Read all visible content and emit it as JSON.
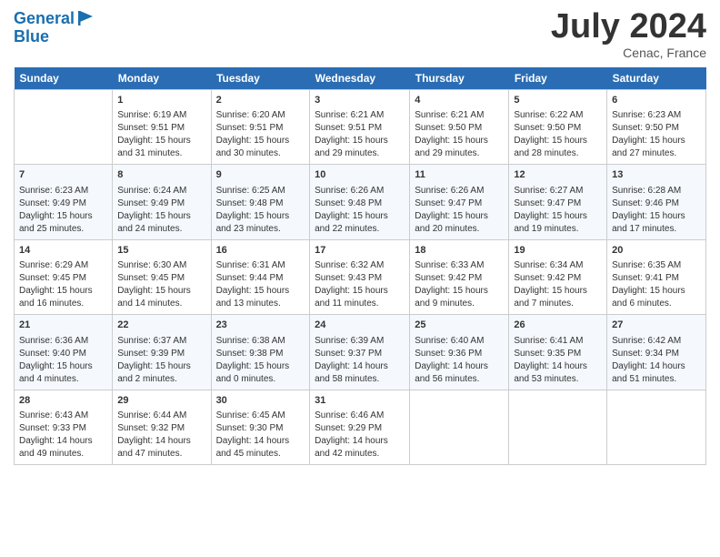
{
  "header": {
    "logo_general": "General",
    "logo_blue": "Blue",
    "month_title": "July 2024",
    "location": "Cenac, France"
  },
  "weekdays": [
    "Sunday",
    "Monday",
    "Tuesday",
    "Wednesday",
    "Thursday",
    "Friday",
    "Saturday"
  ],
  "weeks": [
    [
      {
        "day": "",
        "sunrise": "",
        "sunset": "",
        "daylight": ""
      },
      {
        "day": "1",
        "sunrise": "Sunrise: 6:19 AM",
        "sunset": "Sunset: 9:51 PM",
        "daylight": "Daylight: 15 hours and 31 minutes."
      },
      {
        "day": "2",
        "sunrise": "Sunrise: 6:20 AM",
        "sunset": "Sunset: 9:51 PM",
        "daylight": "Daylight: 15 hours and 30 minutes."
      },
      {
        "day": "3",
        "sunrise": "Sunrise: 6:21 AM",
        "sunset": "Sunset: 9:51 PM",
        "daylight": "Daylight: 15 hours and 29 minutes."
      },
      {
        "day": "4",
        "sunrise": "Sunrise: 6:21 AM",
        "sunset": "Sunset: 9:50 PM",
        "daylight": "Daylight: 15 hours and 29 minutes."
      },
      {
        "day": "5",
        "sunrise": "Sunrise: 6:22 AM",
        "sunset": "Sunset: 9:50 PM",
        "daylight": "Daylight: 15 hours and 28 minutes."
      },
      {
        "day": "6",
        "sunrise": "Sunrise: 6:23 AM",
        "sunset": "Sunset: 9:50 PM",
        "daylight": "Daylight: 15 hours and 27 minutes."
      }
    ],
    [
      {
        "day": "7",
        "sunrise": "Sunrise: 6:23 AM",
        "sunset": "Sunset: 9:49 PM",
        "daylight": "Daylight: 15 hours and 25 minutes."
      },
      {
        "day": "8",
        "sunrise": "Sunrise: 6:24 AM",
        "sunset": "Sunset: 9:49 PM",
        "daylight": "Daylight: 15 hours and 24 minutes."
      },
      {
        "day": "9",
        "sunrise": "Sunrise: 6:25 AM",
        "sunset": "Sunset: 9:48 PM",
        "daylight": "Daylight: 15 hours and 23 minutes."
      },
      {
        "day": "10",
        "sunrise": "Sunrise: 6:26 AM",
        "sunset": "Sunset: 9:48 PM",
        "daylight": "Daylight: 15 hours and 22 minutes."
      },
      {
        "day": "11",
        "sunrise": "Sunrise: 6:26 AM",
        "sunset": "Sunset: 9:47 PM",
        "daylight": "Daylight: 15 hours and 20 minutes."
      },
      {
        "day": "12",
        "sunrise": "Sunrise: 6:27 AM",
        "sunset": "Sunset: 9:47 PM",
        "daylight": "Daylight: 15 hours and 19 minutes."
      },
      {
        "day": "13",
        "sunrise": "Sunrise: 6:28 AM",
        "sunset": "Sunset: 9:46 PM",
        "daylight": "Daylight: 15 hours and 17 minutes."
      }
    ],
    [
      {
        "day": "14",
        "sunrise": "Sunrise: 6:29 AM",
        "sunset": "Sunset: 9:45 PM",
        "daylight": "Daylight: 15 hours and 16 minutes."
      },
      {
        "day": "15",
        "sunrise": "Sunrise: 6:30 AM",
        "sunset": "Sunset: 9:45 PM",
        "daylight": "Daylight: 15 hours and 14 minutes."
      },
      {
        "day": "16",
        "sunrise": "Sunrise: 6:31 AM",
        "sunset": "Sunset: 9:44 PM",
        "daylight": "Daylight: 15 hours and 13 minutes."
      },
      {
        "day": "17",
        "sunrise": "Sunrise: 6:32 AM",
        "sunset": "Sunset: 9:43 PM",
        "daylight": "Daylight: 15 hours and 11 minutes."
      },
      {
        "day": "18",
        "sunrise": "Sunrise: 6:33 AM",
        "sunset": "Sunset: 9:42 PM",
        "daylight": "Daylight: 15 hours and 9 minutes."
      },
      {
        "day": "19",
        "sunrise": "Sunrise: 6:34 AM",
        "sunset": "Sunset: 9:42 PM",
        "daylight": "Daylight: 15 hours and 7 minutes."
      },
      {
        "day": "20",
        "sunrise": "Sunrise: 6:35 AM",
        "sunset": "Sunset: 9:41 PM",
        "daylight": "Daylight: 15 hours and 6 minutes."
      }
    ],
    [
      {
        "day": "21",
        "sunrise": "Sunrise: 6:36 AM",
        "sunset": "Sunset: 9:40 PM",
        "daylight": "Daylight: 15 hours and 4 minutes."
      },
      {
        "day": "22",
        "sunrise": "Sunrise: 6:37 AM",
        "sunset": "Sunset: 9:39 PM",
        "daylight": "Daylight: 15 hours and 2 minutes."
      },
      {
        "day": "23",
        "sunrise": "Sunrise: 6:38 AM",
        "sunset": "Sunset: 9:38 PM",
        "daylight": "Daylight: 15 hours and 0 minutes."
      },
      {
        "day": "24",
        "sunrise": "Sunrise: 6:39 AM",
        "sunset": "Sunset: 9:37 PM",
        "daylight": "Daylight: 14 hours and 58 minutes."
      },
      {
        "day": "25",
        "sunrise": "Sunrise: 6:40 AM",
        "sunset": "Sunset: 9:36 PM",
        "daylight": "Daylight: 14 hours and 56 minutes."
      },
      {
        "day": "26",
        "sunrise": "Sunrise: 6:41 AM",
        "sunset": "Sunset: 9:35 PM",
        "daylight": "Daylight: 14 hours and 53 minutes."
      },
      {
        "day": "27",
        "sunrise": "Sunrise: 6:42 AM",
        "sunset": "Sunset: 9:34 PM",
        "daylight": "Daylight: 14 hours and 51 minutes."
      }
    ],
    [
      {
        "day": "28",
        "sunrise": "Sunrise: 6:43 AM",
        "sunset": "Sunset: 9:33 PM",
        "daylight": "Daylight: 14 hours and 49 minutes."
      },
      {
        "day": "29",
        "sunrise": "Sunrise: 6:44 AM",
        "sunset": "Sunset: 9:32 PM",
        "daylight": "Daylight: 14 hours and 47 minutes."
      },
      {
        "day": "30",
        "sunrise": "Sunrise: 6:45 AM",
        "sunset": "Sunset: 9:30 PM",
        "daylight": "Daylight: 14 hours and 45 minutes."
      },
      {
        "day": "31",
        "sunrise": "Sunrise: 6:46 AM",
        "sunset": "Sunset: 9:29 PM",
        "daylight": "Daylight: 14 hours and 42 minutes."
      },
      {
        "day": "",
        "sunrise": "",
        "sunset": "",
        "daylight": ""
      },
      {
        "day": "",
        "sunrise": "",
        "sunset": "",
        "daylight": ""
      },
      {
        "day": "",
        "sunrise": "",
        "sunset": "",
        "daylight": ""
      }
    ]
  ]
}
